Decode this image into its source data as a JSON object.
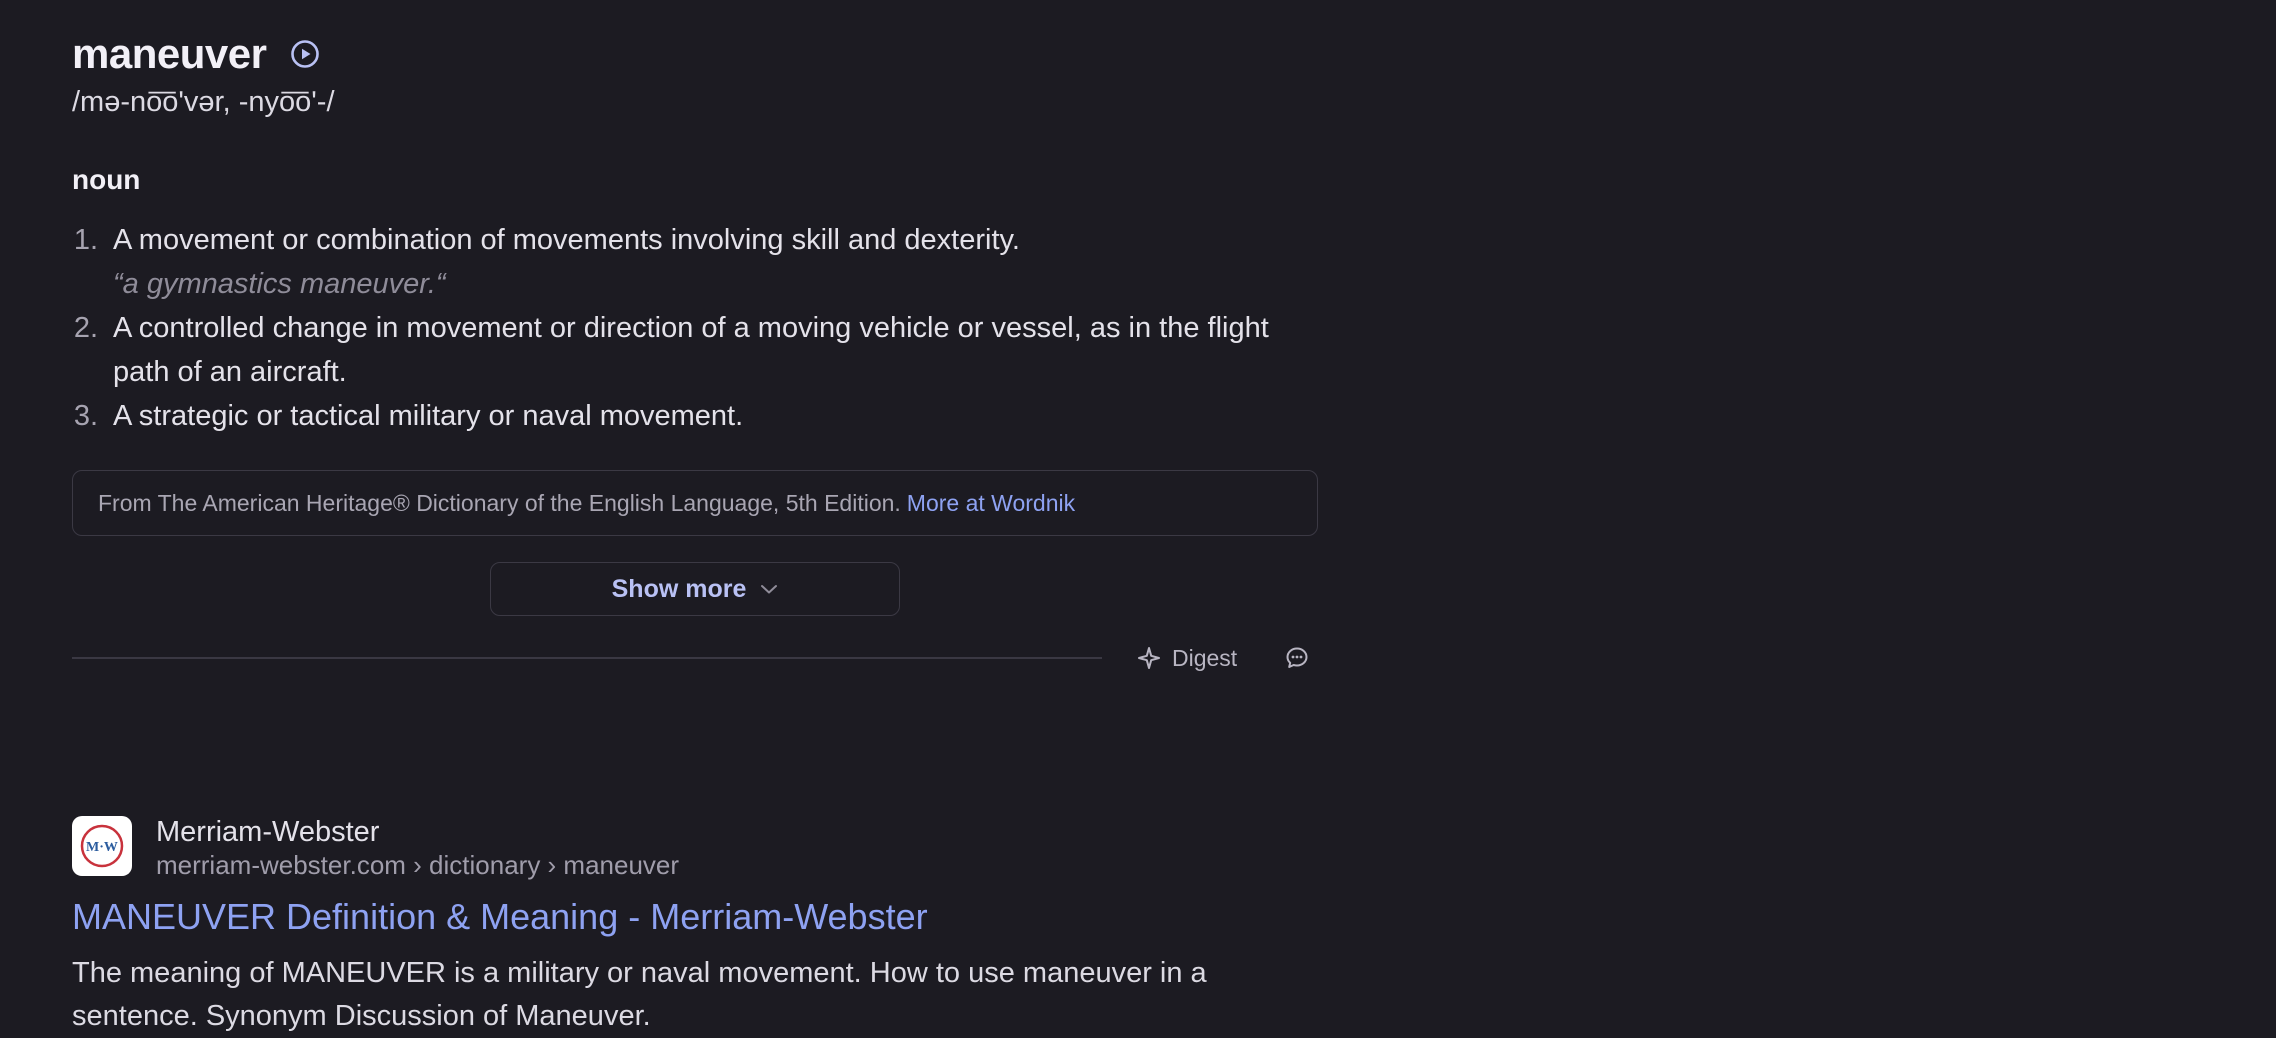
{
  "definition": {
    "word": "maneuver",
    "pronunciation": "/mə-no͞oʹvər, -nyo͞oʹ-/",
    "part_of_speech": "noun",
    "senses": [
      {
        "number": "1.",
        "text": "A movement or combination of movements involving skill and dexterity.",
        "example": "“a gymnastics maneuver.“"
      },
      {
        "number": "2.",
        "text": "A controlled change in movement or direction of a moving vehicle or vessel, as in the flight path of an aircraft."
      },
      {
        "number": "3.",
        "text": "A strategic or tactical military or naval movement."
      }
    ],
    "source_text": "From The American Heritage® Dictionary of the English Language, 5th Edition.",
    "source_link": "More at Wordnik",
    "show_more_label": "Show more",
    "digest_label": "Digest",
    "icons": {
      "play": "play-circle-icon",
      "chevron": "chevron-down-icon",
      "digest": "sparkle-icon",
      "feedback": "chat-bubble-icon"
    }
  },
  "result": {
    "favicon_text": "M·W",
    "site_name": "Merriam-Webster",
    "url": "merriam-webster.com › dictionary › maneuver",
    "title": "MANEUVER Definition & Meaning - Merriam-Webster",
    "snippet": "The meaning of MANEUVER is a military or naval movement. How to use maneuver in a sentence. Synonym Discussion of Maneuver."
  },
  "colors": {
    "background": "#1c1b22",
    "link": "#8ea2f2",
    "accent": "#b9c1f4"
  }
}
